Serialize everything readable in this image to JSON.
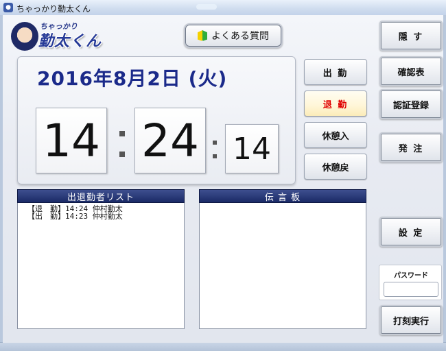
{
  "window": {
    "title": "ちゃっかり勤太くん"
  },
  "logo": {
    "small_text": "ちゃっかり",
    "big_text": "勤太くん"
  },
  "faq_button": {
    "label": "よくある質問"
  },
  "date_display": "2016年8月2日 (火)",
  "clock": {
    "hours": "14",
    "minutes": "24",
    "seconds": "14"
  },
  "punch_buttons": {
    "shukkin": "出 勤",
    "taikin": "退 勤",
    "kyukei_in": "休憩入",
    "kyukei_modori": "休憩戻"
  },
  "side_buttons": {
    "hide": "隠 す",
    "confirm_table": "確認表",
    "auth_register": "認証登録",
    "order": "発 注",
    "settings": "設 定",
    "stamp_execute": "打刻実行"
  },
  "attendance_list": {
    "title": "出退勤者リスト",
    "entries": [
      "【退　勤】14:24 仲村勤太",
      "【出　勤】14:23 仲村勤太"
    ]
  },
  "message_board": {
    "title": "伝 言 板"
  },
  "password": {
    "label": "パスワード",
    "value": ""
  },
  "colors": {
    "date_blue": "#1b2a8a",
    "header_navy": "#1a2a66",
    "taikin_red": "#e00000"
  }
}
